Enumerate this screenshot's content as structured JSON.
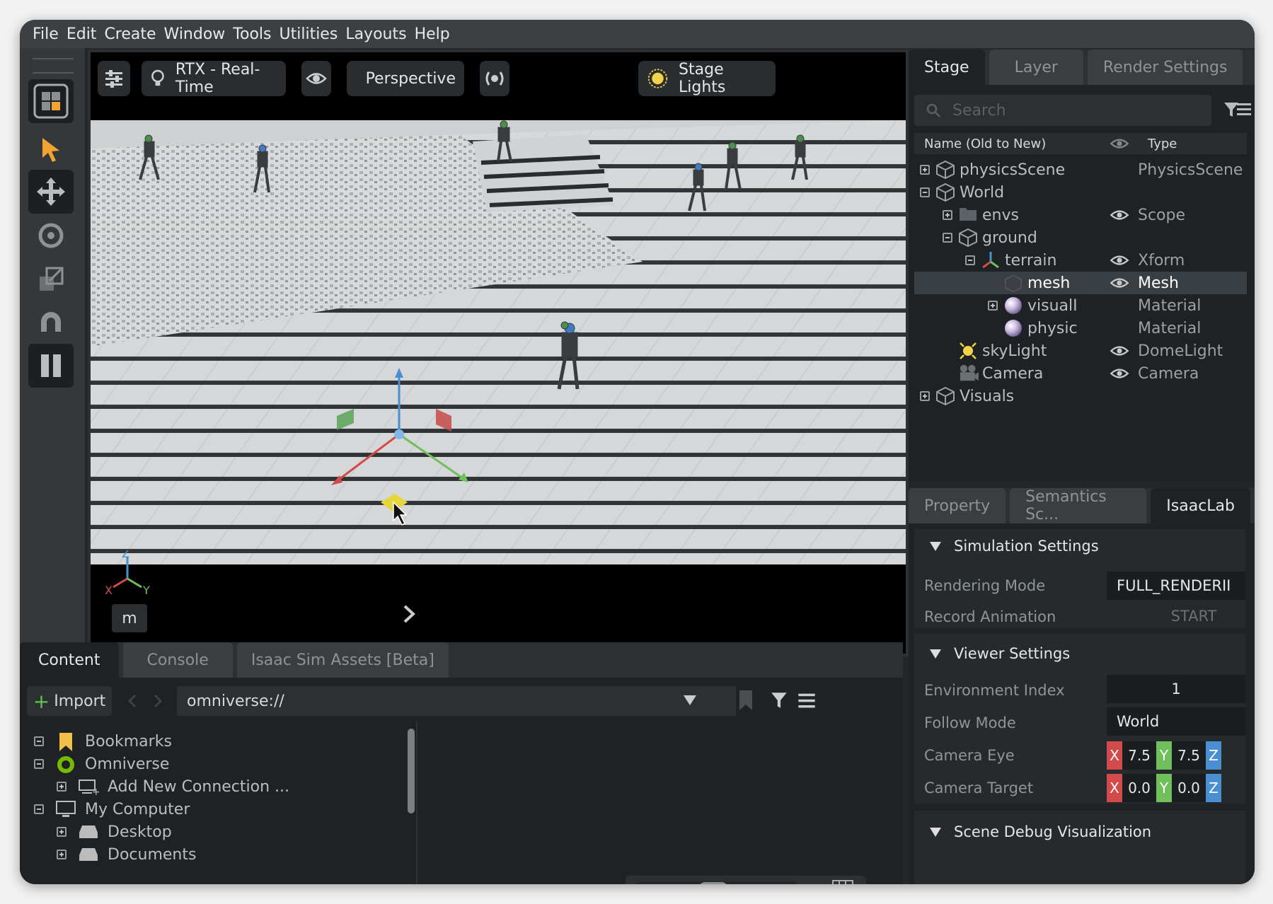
{
  "menu": [
    "File",
    "Edit",
    "Create",
    "Window",
    "Tools",
    "Utilities",
    "Layouts",
    "Help"
  ],
  "viewport": {
    "renderer_label": "RTX - Real-Time",
    "camera_label": "Perspective",
    "lights_label": "Stage Lights",
    "unit_label": "m",
    "axis_labels": {
      "x": "X",
      "y": "Y",
      "z": "Z"
    }
  },
  "stage": {
    "tabs": [
      "Stage",
      "Layer",
      "Render Settings"
    ],
    "search_placeholder": "Search",
    "columns": {
      "name": "Name (Old to New)",
      "type": "Type"
    },
    "rows": [
      {
        "name": "physicsScene",
        "type": "PhysicsScene",
        "icon": "cube-icon",
        "pm": "plus",
        "eye": false,
        "selected": false
      },
      {
        "name": "World",
        "type": "",
        "icon": "cube-icon",
        "pm": "minus",
        "eye": false,
        "selected": false
      },
      {
        "name": "envs",
        "type": "Scope",
        "icon": "folder-icon",
        "pm": "plus",
        "eye": true,
        "selected": false
      },
      {
        "name": "ground",
        "type": "",
        "icon": "cube-icon",
        "pm": "minus",
        "eye": false,
        "selected": false
      },
      {
        "name": "terrain",
        "type": "Xform",
        "icon": "xform-icon",
        "pm": "minus",
        "eye": true,
        "selected": false
      },
      {
        "name": "mesh",
        "type": "Mesh",
        "icon": "mesh-icon",
        "pm": "none",
        "eye": true,
        "selected": true
      },
      {
        "name": "visualI",
        "type": "Material",
        "icon": "material-icon",
        "pm": "plus",
        "eye": false,
        "selected": false
      },
      {
        "name": "physic",
        "type": "Material",
        "icon": "material-icon",
        "pm": "none",
        "eye": false,
        "selected": false
      },
      {
        "name": "skyLight",
        "type": "DomeLight",
        "icon": "light-icon",
        "pm": "none",
        "eye": true,
        "selected": false
      },
      {
        "name": "Camera",
        "type": "Camera",
        "icon": "camera-icon",
        "pm": "none",
        "eye": true,
        "selected": false
      },
      {
        "name": "Visuals",
        "type": "",
        "icon": "cube-icon",
        "pm": "plus",
        "eye": false,
        "selected": false
      }
    ]
  },
  "property": {
    "tabs": [
      "Property",
      "Semantics Sc...",
      "IsaacLab"
    ],
    "simulation": {
      "title": "Simulation Settings",
      "rendering_mode_label": "Rendering Mode",
      "rendering_mode_value": "FULL_RENDERII",
      "record_label": "Record Animation",
      "record_button": "START"
    },
    "viewer": {
      "title": "Viewer Settings",
      "env_index_label": "Environment Index",
      "env_index_value": "1",
      "follow_label": "Follow Mode",
      "follow_value": "World",
      "eye_label": "Camera Eye",
      "eye_x": "7.5",
      "eye_y": "7.5",
      "target_label": "Camera Target",
      "target_x": "0.0",
      "target_y": "0.0",
      "axis_x": "X",
      "axis_y": "Y",
      "axis_z": "Z"
    },
    "scene_debug_title": "Scene Debug Visualization"
  },
  "content": {
    "tabs": [
      "Content",
      "Console",
      "Isaac Sim Assets [Beta]"
    ],
    "import_label": "Import",
    "path": "omniverse://",
    "tree": [
      {
        "label": "Bookmarks",
        "pm": "minus",
        "icon": "bookmark-icon",
        "indent": 0
      },
      {
        "label": "Omniverse",
        "pm": "minus",
        "icon": "omniverse-icon",
        "indent": 0
      },
      {
        "label": "Add New Connection ...",
        "pm": "plus",
        "icon": "server-icon",
        "indent": 1
      },
      {
        "label": "My Computer",
        "pm": "minus",
        "icon": "monitor-icon",
        "indent": 0
      },
      {
        "label": "Desktop",
        "pm": "plus",
        "icon": "drive-icon",
        "indent": 1
      },
      {
        "label": "Documents",
        "pm": "plus",
        "icon": "drive-icon",
        "indent": 1
      }
    ]
  },
  "colors": {
    "x_axis": "#d24b4b",
    "y_axis": "#6fbf5a",
    "z_axis": "#4a8fd1",
    "selection": "#3a3f43",
    "accent_orange": "#f2a431"
  }
}
